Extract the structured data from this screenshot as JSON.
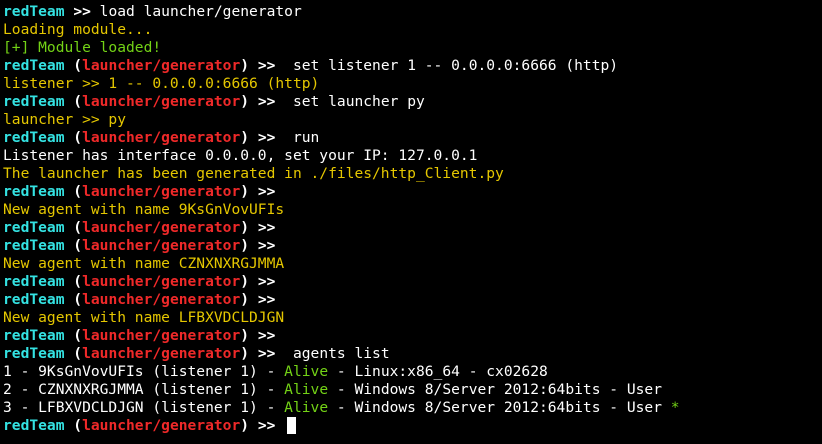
{
  "terminal": {
    "colors": {
      "background": "#000000",
      "prompt_user": "#34e2e2",
      "prompt_module": "#ef2929",
      "text": "#ffffff",
      "info": "#e5c700",
      "success": "#73d216"
    },
    "lines": [
      {
        "type": "prompt_root",
        "user": "redTeam",
        "arrow": ">>",
        "command": " load launcher/generator"
      },
      {
        "type": "output",
        "text": "Loading module...",
        "color": "yellow"
      },
      {
        "type": "output",
        "text": "[+] Module loaded!",
        "color": "green"
      },
      {
        "type": "prompt_module",
        "user": "redTeam",
        "module": "launcher/generator",
        "arrow": ">>",
        "command": "  set listener 1 -- 0.0.0.0:6666 (http)"
      },
      {
        "type": "output",
        "text": "listener >> 1 -- 0.0.0.0:6666 (http)",
        "color": "yellow"
      },
      {
        "type": "prompt_module",
        "user": "redTeam",
        "module": "launcher/generator",
        "arrow": ">>",
        "command": "  set launcher py"
      },
      {
        "type": "output",
        "text": "launcher >> py",
        "color": "yellow"
      },
      {
        "type": "prompt_module",
        "user": "redTeam",
        "module": "launcher/generator",
        "arrow": ">>",
        "command": "  run"
      },
      {
        "type": "output",
        "text": "Listener has interface 0.0.0.0, set your IP: 127.0.0.1",
        "color": "white"
      },
      {
        "type": "output",
        "text": "The launcher has been generated in ./files/http_Client.py",
        "color": "yellow"
      },
      {
        "type": "prompt_module",
        "user": "redTeam",
        "module": "launcher/generator",
        "arrow": ">>",
        "command": ""
      },
      {
        "type": "output",
        "text": "New agent with name 9KsGnVovUFIs",
        "color": "yellow"
      },
      {
        "type": "prompt_module",
        "user": "redTeam",
        "module": "launcher/generator",
        "arrow": ">>",
        "command": ""
      },
      {
        "type": "prompt_module",
        "user": "redTeam",
        "module": "launcher/generator",
        "arrow": ">>",
        "command": ""
      },
      {
        "type": "output",
        "text": "New agent with name CZNXNXRGJMMA",
        "color": "yellow"
      },
      {
        "type": "prompt_module",
        "user": "redTeam",
        "module": "launcher/generator",
        "arrow": ">>",
        "command": ""
      },
      {
        "type": "prompt_module",
        "user": "redTeam",
        "module": "launcher/generator",
        "arrow": ">>",
        "command": ""
      },
      {
        "type": "output",
        "text": "New agent with name LFBXVDCLDJGN",
        "color": "yellow"
      },
      {
        "type": "prompt_module",
        "user": "redTeam",
        "module": "launcher/generator",
        "arrow": ">>",
        "command": ""
      },
      {
        "type": "prompt_module",
        "user": "redTeam",
        "module": "launcher/generator",
        "arrow": ">>",
        "command": "  agents list"
      },
      {
        "type": "agent",
        "prefix": "1 - 9KsGnVovUFIs (listener 1) - ",
        "status": "Alive",
        "suffix": " - Linux:x86_64 - cx02628",
        "star": ""
      },
      {
        "type": "agent",
        "prefix": "2 - CZNXNXRGJMMA (listener 1) - ",
        "status": "Alive",
        "suffix": " - Windows 8/Server 2012:64bits - User",
        "star": ""
      },
      {
        "type": "agent",
        "prefix": "3 - LFBXVDCLDJGN (listener 1) - ",
        "status": "Alive",
        "suffix": " - Windows 8/Server 2012:64bits - User ",
        "star": "*"
      },
      {
        "type": "prompt_module",
        "user": "redTeam",
        "module": "launcher/generator",
        "arrow": ">>",
        "command": " ",
        "cursor": true
      }
    ]
  }
}
